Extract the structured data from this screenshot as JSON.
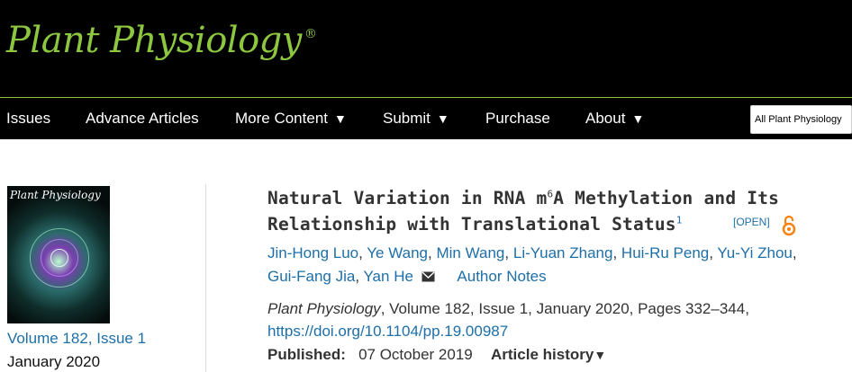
{
  "journal": {
    "name": "Plant Physiology",
    "registered_mark": "®"
  },
  "nav": {
    "items": [
      {
        "label": "Issues",
        "caret": ""
      },
      {
        "label": "Advance Articles",
        "caret": ""
      },
      {
        "label": "More Content",
        "caret": "▼"
      },
      {
        "label": "Submit",
        "caret": "▼"
      },
      {
        "label": "Purchase",
        "caret": ""
      },
      {
        "label": "About",
        "caret": "▼"
      }
    ],
    "search_scope": "All Plant Physiology"
  },
  "issue": {
    "cover_title": "Plant Physiology",
    "link": "Volume 182, Issue 1",
    "date": "January 2020"
  },
  "article": {
    "title_line1": "Natural Variation in RNA m",
    "title_sup6": "6",
    "title_line1_end": "A Methylation and Its",
    "title_line2": "Relationship with Translational Status",
    "title_footnote": "1",
    "open_label": "[OPEN]",
    "authors_line1": [
      "Jin-Hong Luo",
      "Ye Wang",
      "Min Wang",
      "Li-Yuan Zhang",
      "Hui-Ru Peng",
      "Yu-Yi Zhou"
    ],
    "authors_line2": [
      "Gui-Fang Jia",
      "Yan He"
    ],
    "separator": ",",
    "author_notes": "Author Notes",
    "citation_journal": "Plant Physiology",
    "citation_rest": ", Volume 182, Issue 1, January 2020, Pages 332–344,",
    "doi": "https://doi.org/10.1104/pp.19.00987",
    "published_label": "Published:",
    "published_date": "07 October 2019",
    "history_label": "Article history",
    "history_caret": "▼"
  },
  "colors": {
    "brand_green": "#8dc63f",
    "link_blue": "#1e6fa8",
    "open_access_orange": "#f68212"
  }
}
